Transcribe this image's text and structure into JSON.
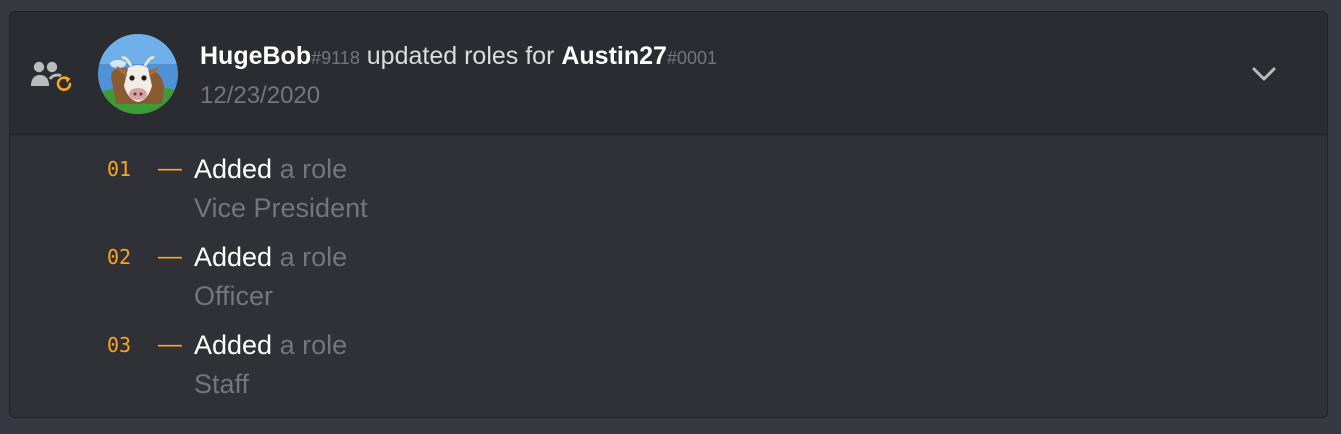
{
  "audit_entry": {
    "actor": {
      "name": "HugeBob",
      "discriminator": "#9118"
    },
    "action_text": "updated roles for",
    "target": {
      "name": "Austin27",
      "discriminator": "#0001"
    },
    "date": "12/23/2020",
    "action_icon": "member-role-update-icon",
    "avatar_icon": "cow-avatar",
    "expand_icon": "chevron-down-icon",
    "changes": [
      {
        "number": "01",
        "separator": "—",
        "verb": "Added",
        "detail": "a role",
        "value": "Vice President"
      },
      {
        "number": "02",
        "separator": "—",
        "verb": "Added",
        "detail": "a role",
        "value": "Officer"
      },
      {
        "number": "03",
        "separator": "—",
        "verb": "Added",
        "detail": "a role",
        "value": "Staff"
      }
    ]
  },
  "colors": {
    "background": "#36393f",
    "card": "#2f3136",
    "header": "#2a2c31",
    "accent_orange": "#faa61a",
    "muted_text": "#72767d",
    "bright_text": "#ffffff"
  }
}
